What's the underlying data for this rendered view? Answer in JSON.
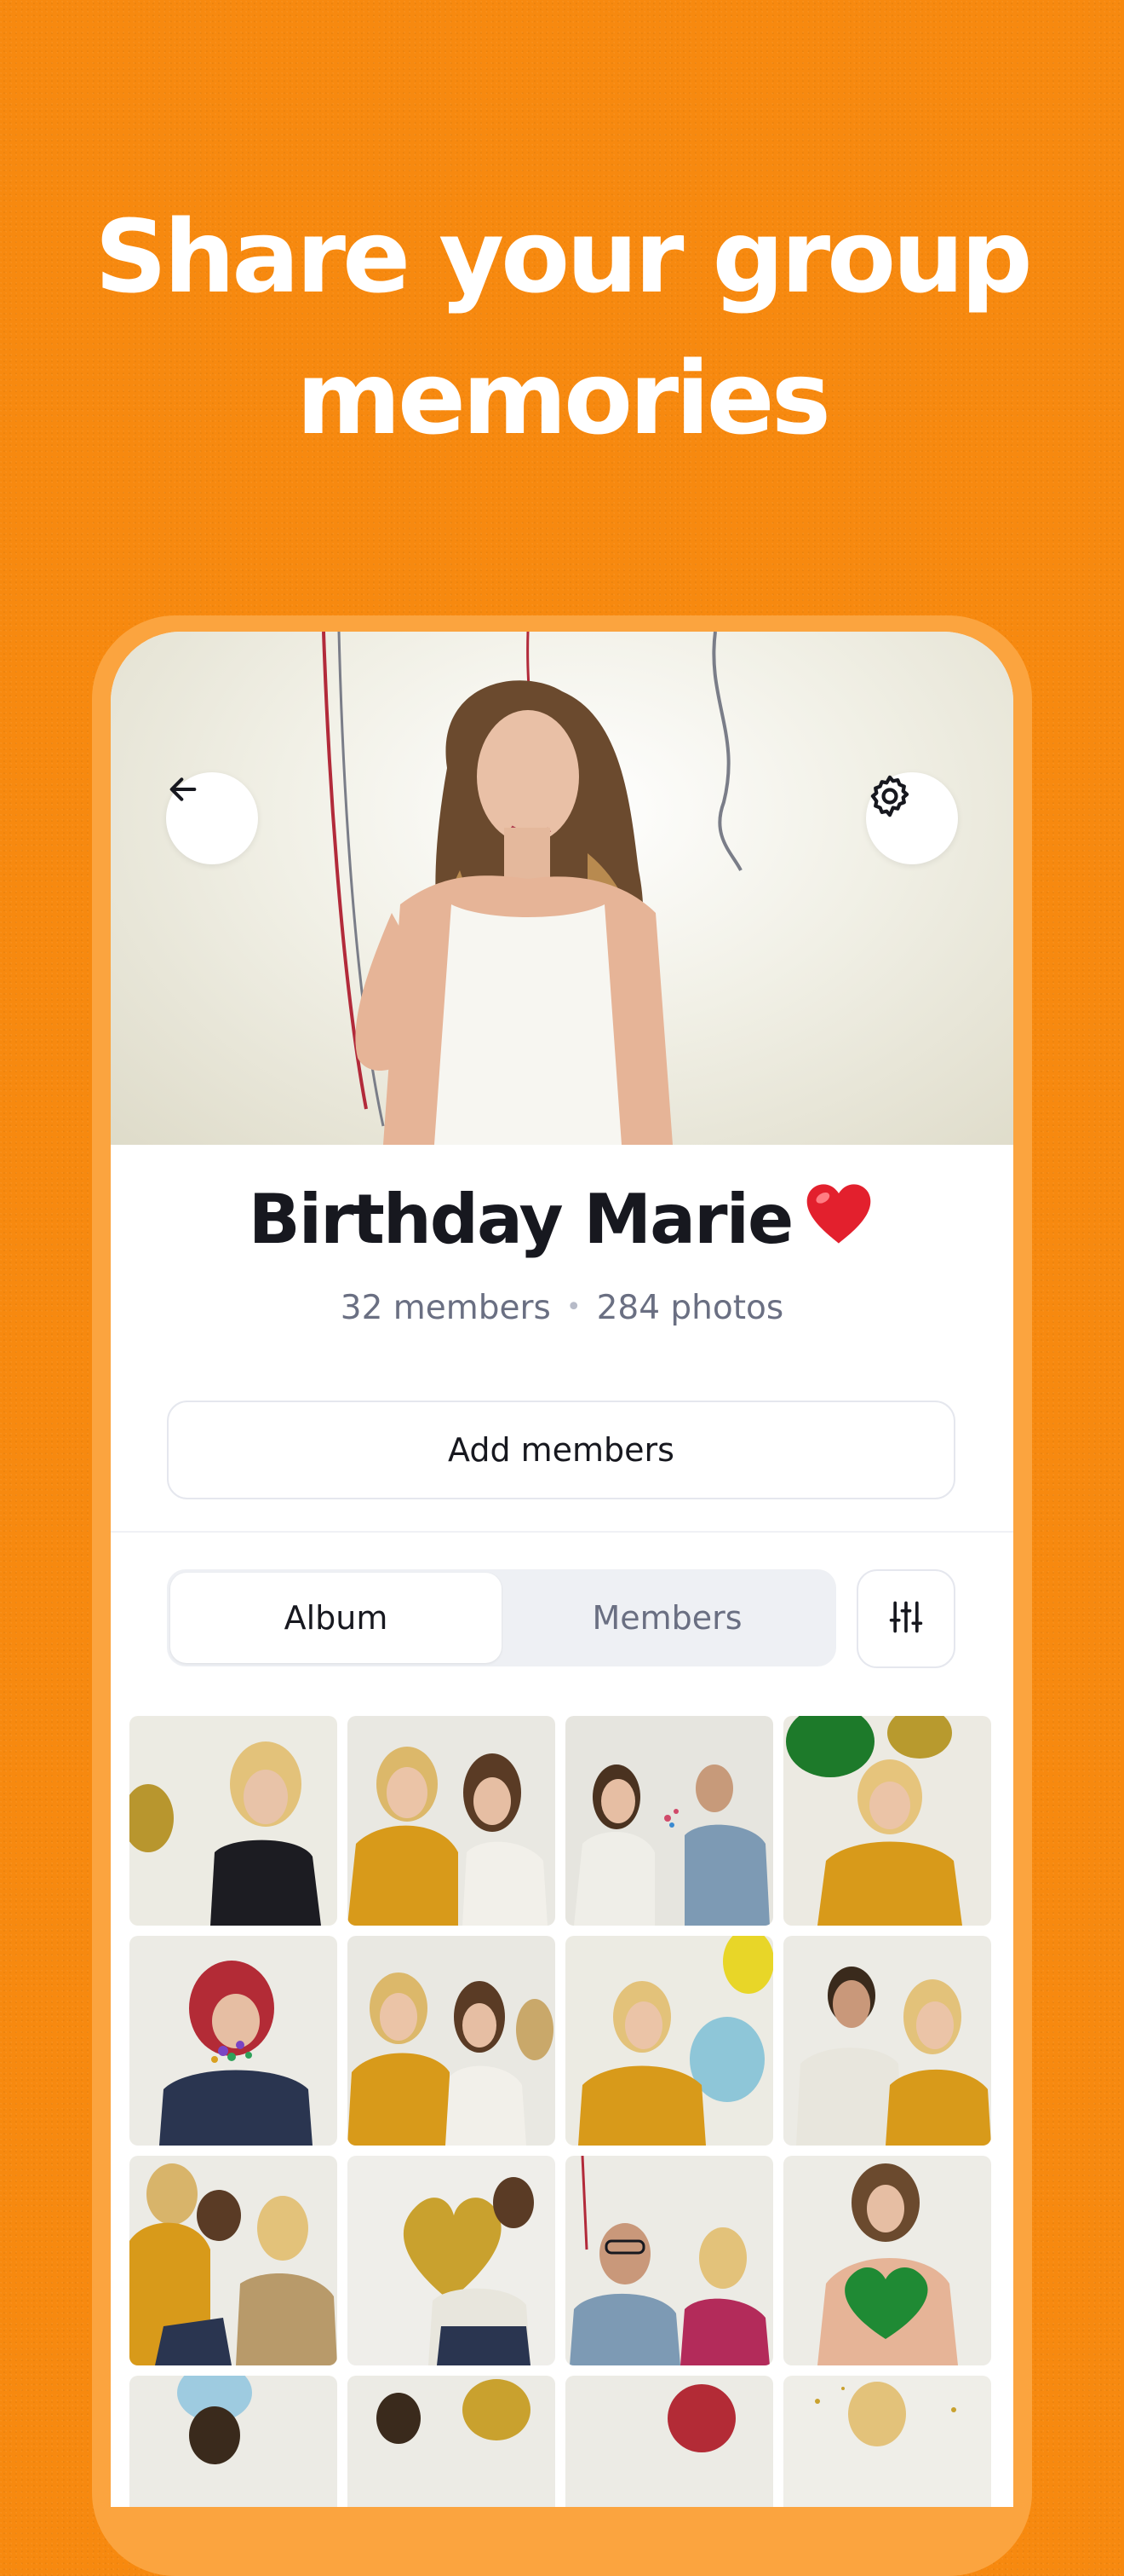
{
  "headline": {
    "line1": "Share your group",
    "line2": "memories"
  },
  "group": {
    "title": "Birthday Marie",
    "emoji": "heart-emoji",
    "members_count": "32 members",
    "photos_count": "284 photos",
    "separator": "•"
  },
  "actions": {
    "add_members_label": "Add members"
  },
  "tabs": {
    "album_label": "Album",
    "members_label": "Members",
    "active": "Album"
  },
  "icons": {
    "back": "arrow-left-icon",
    "settings": "gear-icon",
    "filter": "sliders-icon"
  },
  "colors": {
    "background": "#F7890F",
    "frame": "#FBA43F",
    "title_text": "#17181F",
    "muted_text": "#6A6F82",
    "segment_bg": "#EEF0F4"
  },
  "photos": [
    {
      "alt": "blonde woman with gold balloon"
    },
    {
      "alt": "two friends in yellow jacket"
    },
    {
      "alt": "couple with confetti"
    },
    {
      "alt": "woman with green balloon"
    },
    {
      "alt": "red-haired woman blowing confetti"
    },
    {
      "alt": "three friends posing"
    },
    {
      "alt": "woman with yellow and blue balloons"
    },
    {
      "alt": "smiling couple"
    },
    {
      "alt": "friends laughing"
    },
    {
      "alt": "woman with gold heart balloon"
    },
    {
      "alt": "man with glasses and friend"
    },
    {
      "alt": "woman holding green heart balloon"
    },
    {
      "alt": "party photo"
    },
    {
      "alt": "party photo"
    },
    {
      "alt": "party photo"
    },
    {
      "alt": "party photo"
    }
  ]
}
